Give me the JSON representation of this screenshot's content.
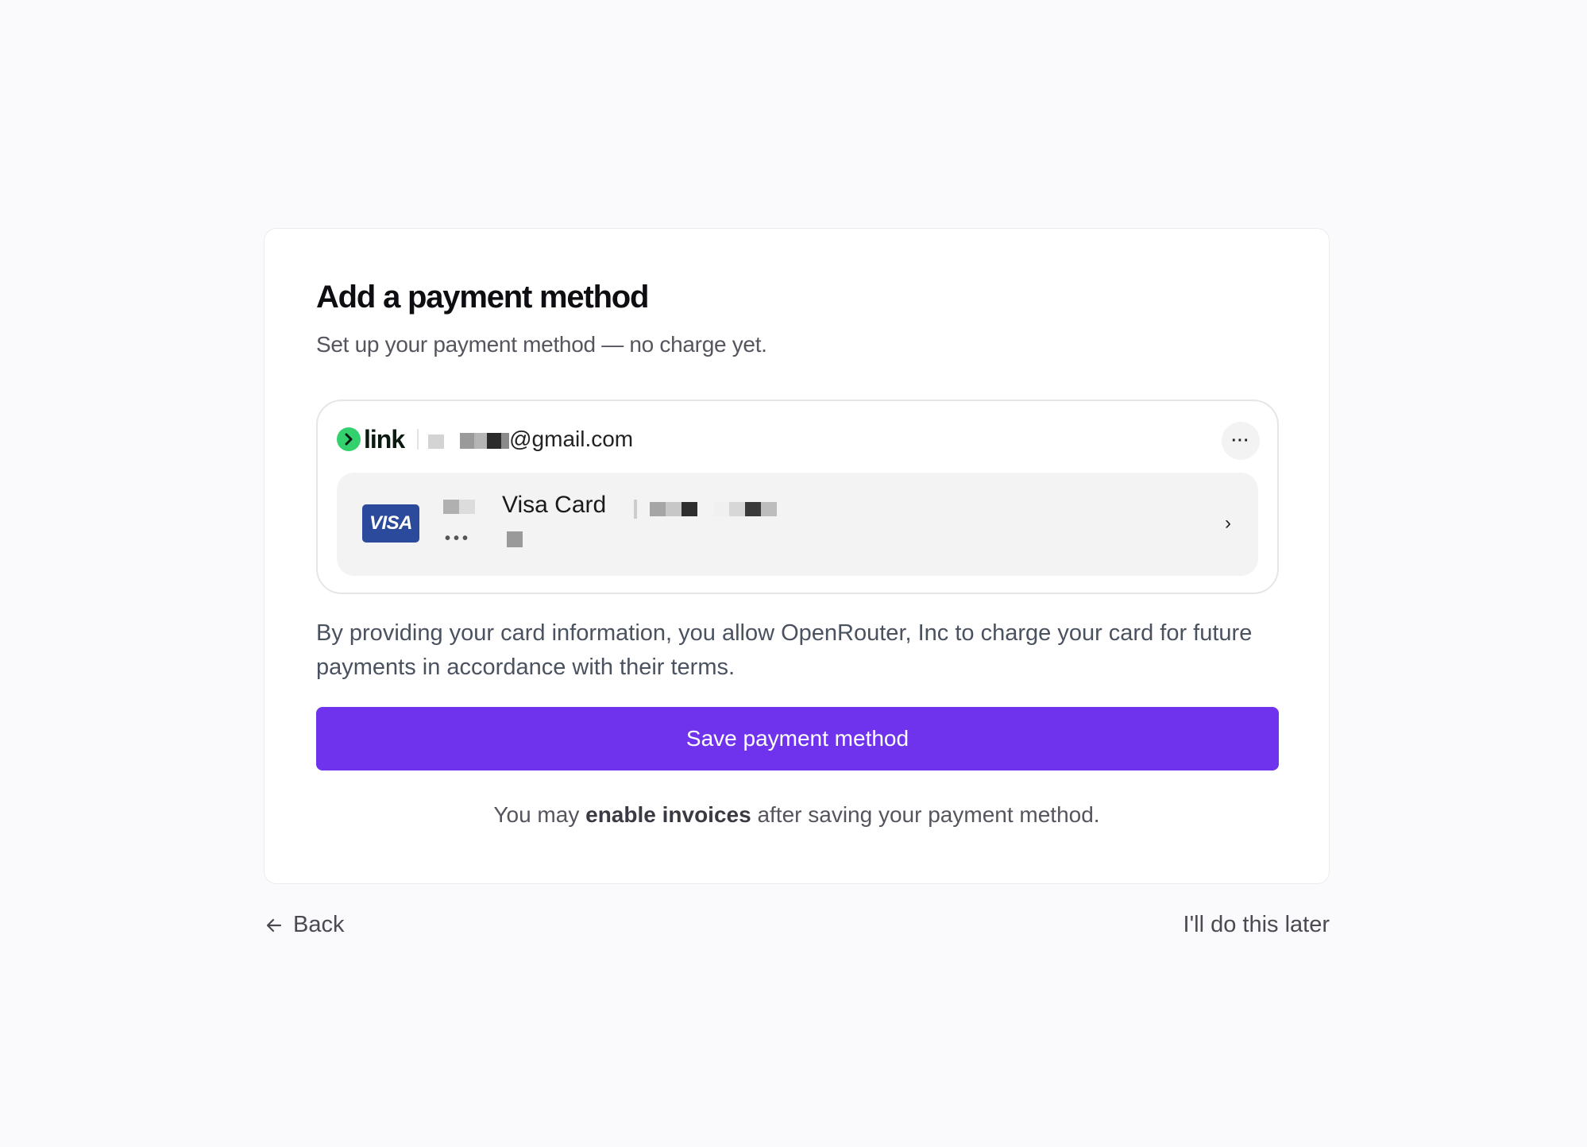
{
  "card": {
    "title": "Add a payment method",
    "subtitle": "Set up your payment method — no charge yet."
  },
  "link": {
    "logo_text": "link",
    "logo_icon": "link-arrow-icon",
    "email_suffix": "@gmail.com",
    "more_label": "···",
    "saved_card": {
      "brand": "VISA",
      "name": "Visa Card",
      "mask_dots": "•••",
      "chevron": "›"
    }
  },
  "consent_text": "By providing your card information, you allow OpenRouter, Inc to charge your card for future payments in accordance with their terms.",
  "save_button": "Save payment method",
  "footnote": {
    "prefix": "You may ",
    "bold": "enable invoices",
    "suffix": " after saving your payment method."
  },
  "nav": {
    "back_label": "Back",
    "later_label": "I'll do this later"
  },
  "colors": {
    "primary": "#7033ed",
    "link_green": "#33d16e",
    "visa_blue": "#2b4a9b"
  }
}
